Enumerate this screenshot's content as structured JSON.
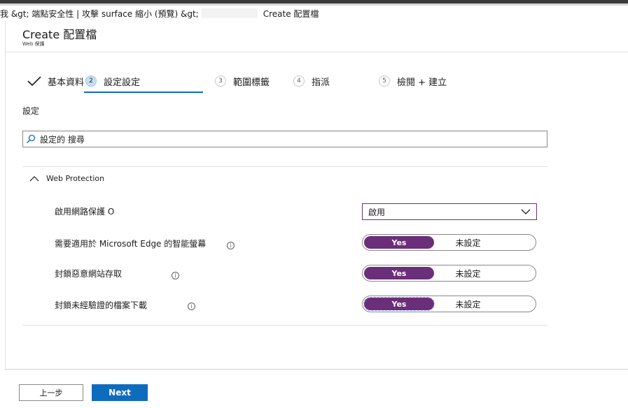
{
  "breadcrumb": {
    "part1": "我 &gt; 端點安全性 | 攻擊 surface 縮小 (預覽) &gt;",
    "part2": "Create 配置檔"
  },
  "header": {
    "title": "Create 配置檔",
    "subtitle": "Web 保護"
  },
  "steps": [
    {
      "num": "",
      "label": "基本資料",
      "state": "done"
    },
    {
      "num": "2",
      "label": "設定設定",
      "state": "active"
    },
    {
      "num": "3",
      "label": "範圍標籤",
      "state": "pending"
    },
    {
      "num": "4",
      "label": "指派",
      "state": "pending"
    },
    {
      "num": "5",
      "label": "檢閱 + 建立",
      "state": "pending"
    }
  ],
  "settings": {
    "section_label": "設定",
    "search_placeholder": "設定的 搜尋",
    "group_title": "Web Protection",
    "rows": [
      {
        "label": "啟用網路保護 O",
        "control": "dropdown",
        "value": "啟用"
      },
      {
        "label": "需要適用於 Microsoft Edge 的智能螢幕",
        "info": "i",
        "control": "toggle",
        "on": "Yes",
        "off": "未設定",
        "selected": "Yes"
      },
      {
        "label": "封鎖惡意網站存取",
        "info": "i",
        "control": "toggle",
        "on": "Yes",
        "off": "未設定",
        "selected": "Yes"
      },
      {
        "label": "封鎖未經驗證的檔案下載",
        "info": "i",
        "control": "toggle",
        "on": "Yes",
        "off": "未設定",
        "selected": "Yes"
      }
    ]
  },
  "footer": {
    "back_label": "上一步",
    "next_label": "Next"
  },
  "colors": {
    "accent_purple": "#6b2e7a",
    "primary_blue": "#0f6cbd",
    "step_active_bg": "#c7e0f4"
  }
}
